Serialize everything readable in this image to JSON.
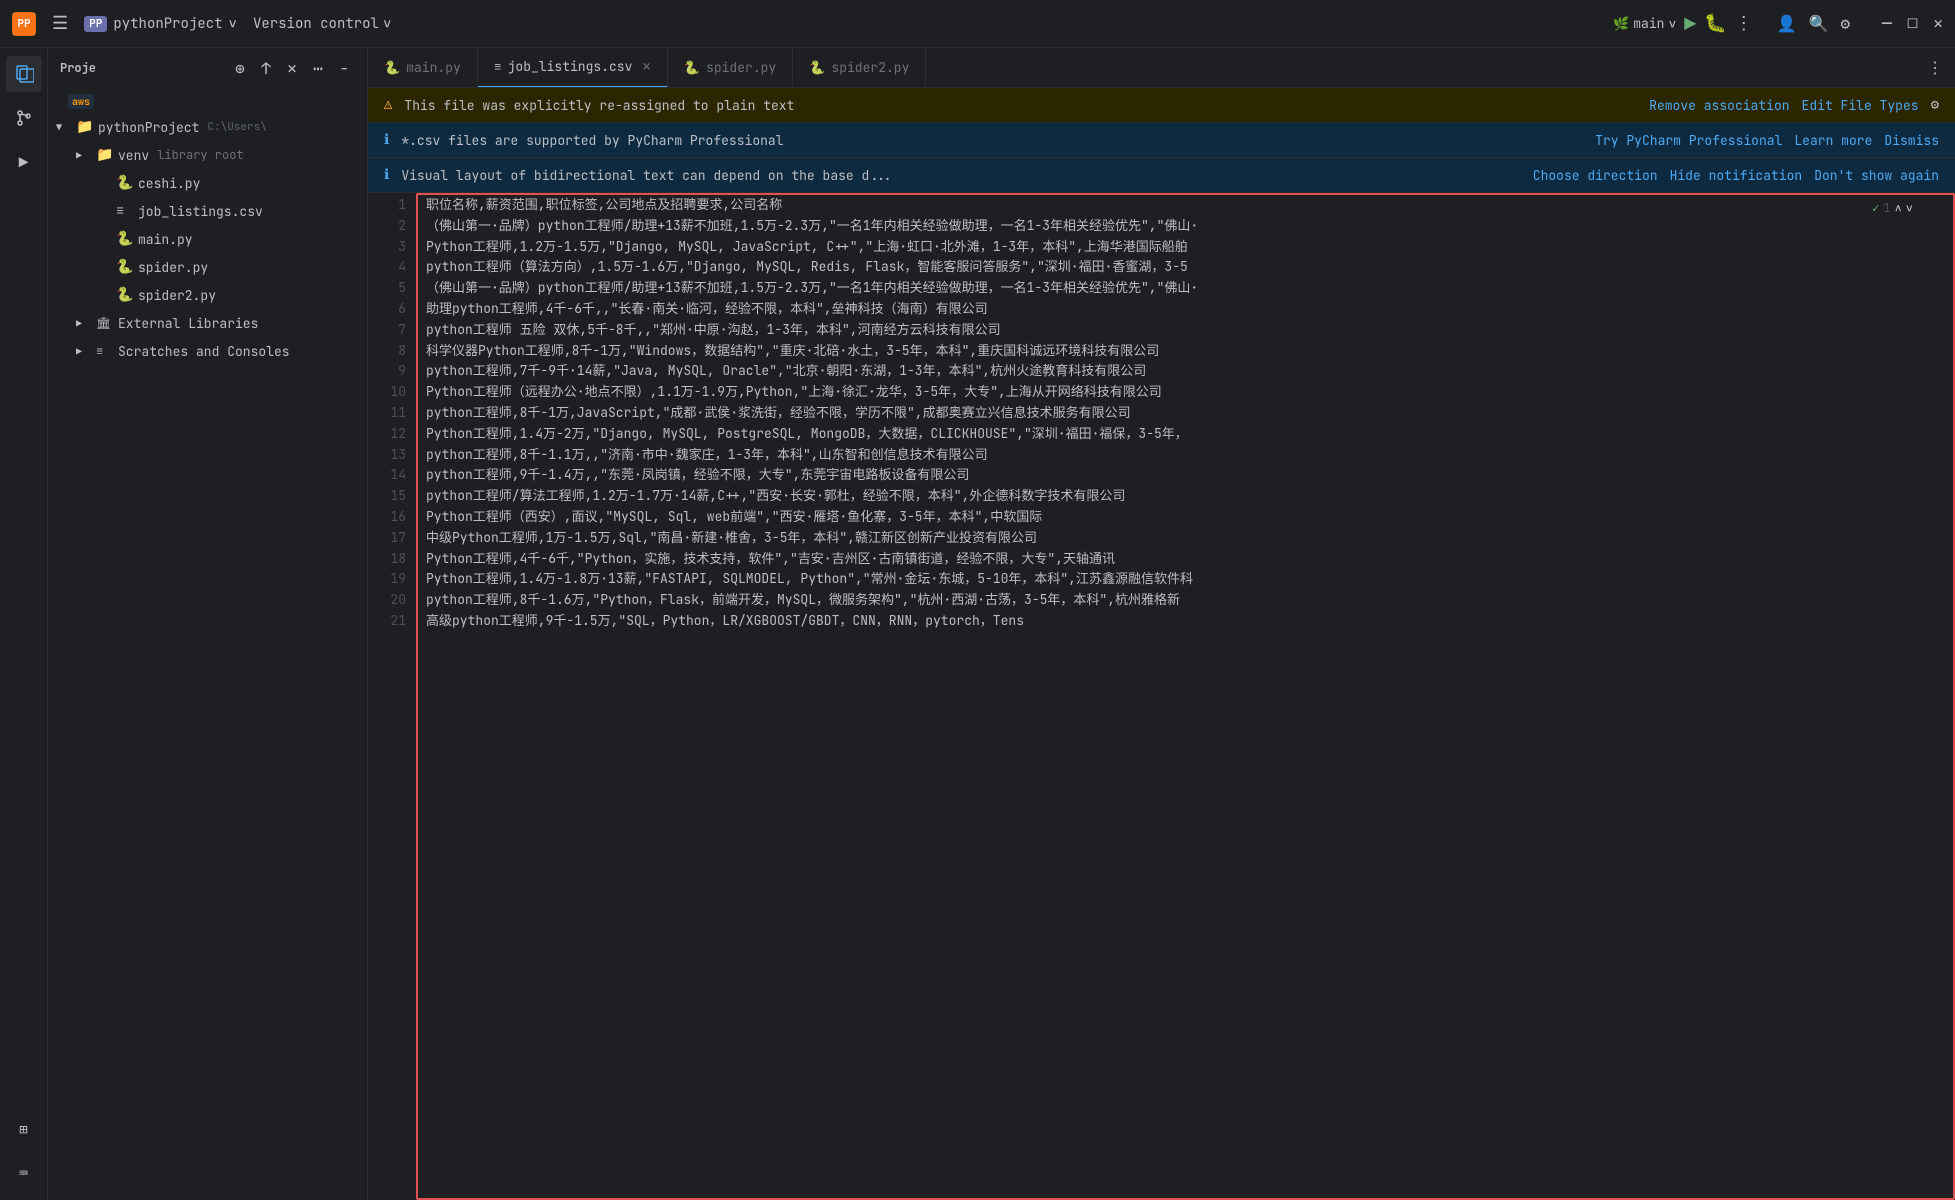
{
  "titleBar": {
    "logoText": "PP",
    "projectName": "pythonProject",
    "versionControl": "Version control",
    "branchName": "main",
    "icons": {
      "hamburger": "☰",
      "chevron": "∨",
      "run": "▶",
      "debug": "🐛",
      "profile": "👤",
      "search": "🔍",
      "settings": "⚙",
      "more": "⋮",
      "minimize": "─",
      "maximize": "□",
      "close": "✕"
    }
  },
  "tabs": [
    {
      "label": "main.py",
      "icon": "🐍",
      "active": false,
      "closable": false
    },
    {
      "label": "job_listings.csv",
      "icon": "≡",
      "active": true,
      "closable": true
    },
    {
      "label": "spider.py",
      "icon": "🐍",
      "active": false,
      "closable": false
    },
    {
      "label": "spider2.py",
      "icon": "🐍",
      "active": false,
      "closable": false
    }
  ],
  "notifications": [
    {
      "type": "warning",
      "icon": "⚠",
      "text": "This file was explicitly re-assigned to plain text",
      "actions": [
        "Remove association",
        "Edit File Types"
      ],
      "hasGear": true
    },
    {
      "type": "info",
      "icon": "ℹ",
      "text": "*.csv files are supported by PyCharm Professional",
      "actions": [
        "Try PyCharm Professional",
        "Learn more",
        "Dismiss"
      ],
      "hasGear": false
    },
    {
      "type": "info",
      "icon": "ℹ",
      "text": "Visual layout of bidirectional text can depend on the base d...",
      "actions": [
        "Choose direction",
        "Hide notification",
        "Don't show again"
      ],
      "hasGear": false
    }
  ],
  "editor": {
    "findCount": "1",
    "lines": [
      "职位名称,薪资范围,职位标签,公司地点及招聘要求,公司名称",
      "（佛山第一·品牌）python工程师/助理+13薪不加班,1.5万-2.3万,\"一名1年内相关经验做助理，一名1-3年相关经验优先\",\"佛山·",
      "Python工程师,1.2万-1.5万,\"Django, MySQL, JavaScript, C++\",\"上海·虹口·北外滩，1-3年，本科\",上海华港国际船舶",
      "python工程师（算法方向）,1.5万-1.6万,\"Django, MySQL, Redis, Flask，智能客服问答服务\",\"深圳·福田·香蜜湖，3-5",
      "（佛山第一·品牌）python工程师/助理+13薪不加班,1.5万-2.3万,\"一名1年内相关经验做助理，一名1-3年相关经验优先\",\"佛山·",
      "助理python工程师,4千-6千,,\"长春·南关·临河，经验不限，本科\",垒神科技（海南）有限公司",
      "python工程师 五险 双休,5千-8千,,\"郑州·中原·沟赵，1-3年，本科\",河南经方云科技有限公司",
      "科学仪器Python工程师,8千-1万,\"Windows，数据结构\",\"重庆·北碚·水土，3-5年，本科\",重庆国科诚远环境科技有限公司",
      "python工程师,7千-9千·14薪,\"Java, MySQL, Oracle\",\"北京·朝阳·东湖，1-3年，本科\",杭州火途教育科技有限公司",
      "Python工程师（远程办公·地点不限）,1.1万-1.9万,Python,\"上海·徐汇·龙华，3-5年，大专\",上海从开网络科技有限公司",
      "python工程师,8千-1万,JavaScript,\"成都·武侯·浆洗街，经验不限，学历不限\",成都奥赛立兴信息技术服务有限公司",
      "Python工程师,1.4万-2万,\"Django, MySQL, PostgreSQL, MongoDB，大数据，CLICKHOUSE\",\"深圳·福田·福保，3-5年，",
      "python工程师,8千-1.1万,,\"济南·市中·魏家庄，1-3年，本科\",山东智和创信息技术有限公司",
      "python工程师,9千-1.4万,,\"东莞·凤岗镇，经验不限，大专\",东莞宇宙电路板设备有限公司",
      "python工程师/算法工程师,1.2万-1.7万·14薪,C++,\"西安·长安·郭杜，经验不限，本科\",外企德科数字技术有限公司",
      "Python工程师（西安）,面议,\"MySQL, Sql, web前端\",\"西安·雁塔·鱼化寨，3-5年，本科\",中软国际",
      "中级Python工程师,1万-1.5万,Sql,\"南昌·新建·椎舍，3-5年，本科\",赣江新区创新产业投资有限公司",
      "Python工程师,4千-6千,\"Python，实施，技术支持，软件\",\"吉安·吉州区·古南镇街道，经验不限，大专\",天轴通讯",
      "Python工程师,1.4万-1.8万·13薪,\"FASTAPI, SQLMODEL, Python\",\"常州·金坛·东城，5-10年，本科\",江苏鑫源融信软件科",
      "python工程师,8千-1.6万,\"Python，Flask，前端开发，MySQL，微服务架构\",\"杭州·西湖·古荡，3-5年，本科\",杭州雅格新",
      "高级python工程师,9千-1.5万,\"SQL，Python，LR/XGBOOST/GBDT，CNN，RNN，pytorch，Tens"
    ]
  },
  "sidebar": {
    "title": "Proje",
    "rootProject": "pythonProject",
    "rootPath": "C:\\Users\\",
    "items": [
      {
        "label": "venv",
        "type": "folder",
        "extra": "library root",
        "level": 1
      },
      {
        "label": "ceshi.py",
        "type": "python",
        "level": 2
      },
      {
        "label": "job_listings.csv",
        "type": "csv",
        "level": 2
      },
      {
        "label": "main.py",
        "type": "python",
        "level": 2
      },
      {
        "label": "spider.py",
        "type": "python",
        "level": 2
      },
      {
        "label": "spider2.py",
        "type": "python",
        "level": 2
      },
      {
        "label": "External Libraries",
        "type": "folder",
        "level": 1
      },
      {
        "label": "Scratches and Consoles",
        "type": "scratches",
        "level": 1
      }
    ],
    "actions": [
      "⊕",
      "↑",
      "✕",
      "⋯",
      "−"
    ]
  }
}
